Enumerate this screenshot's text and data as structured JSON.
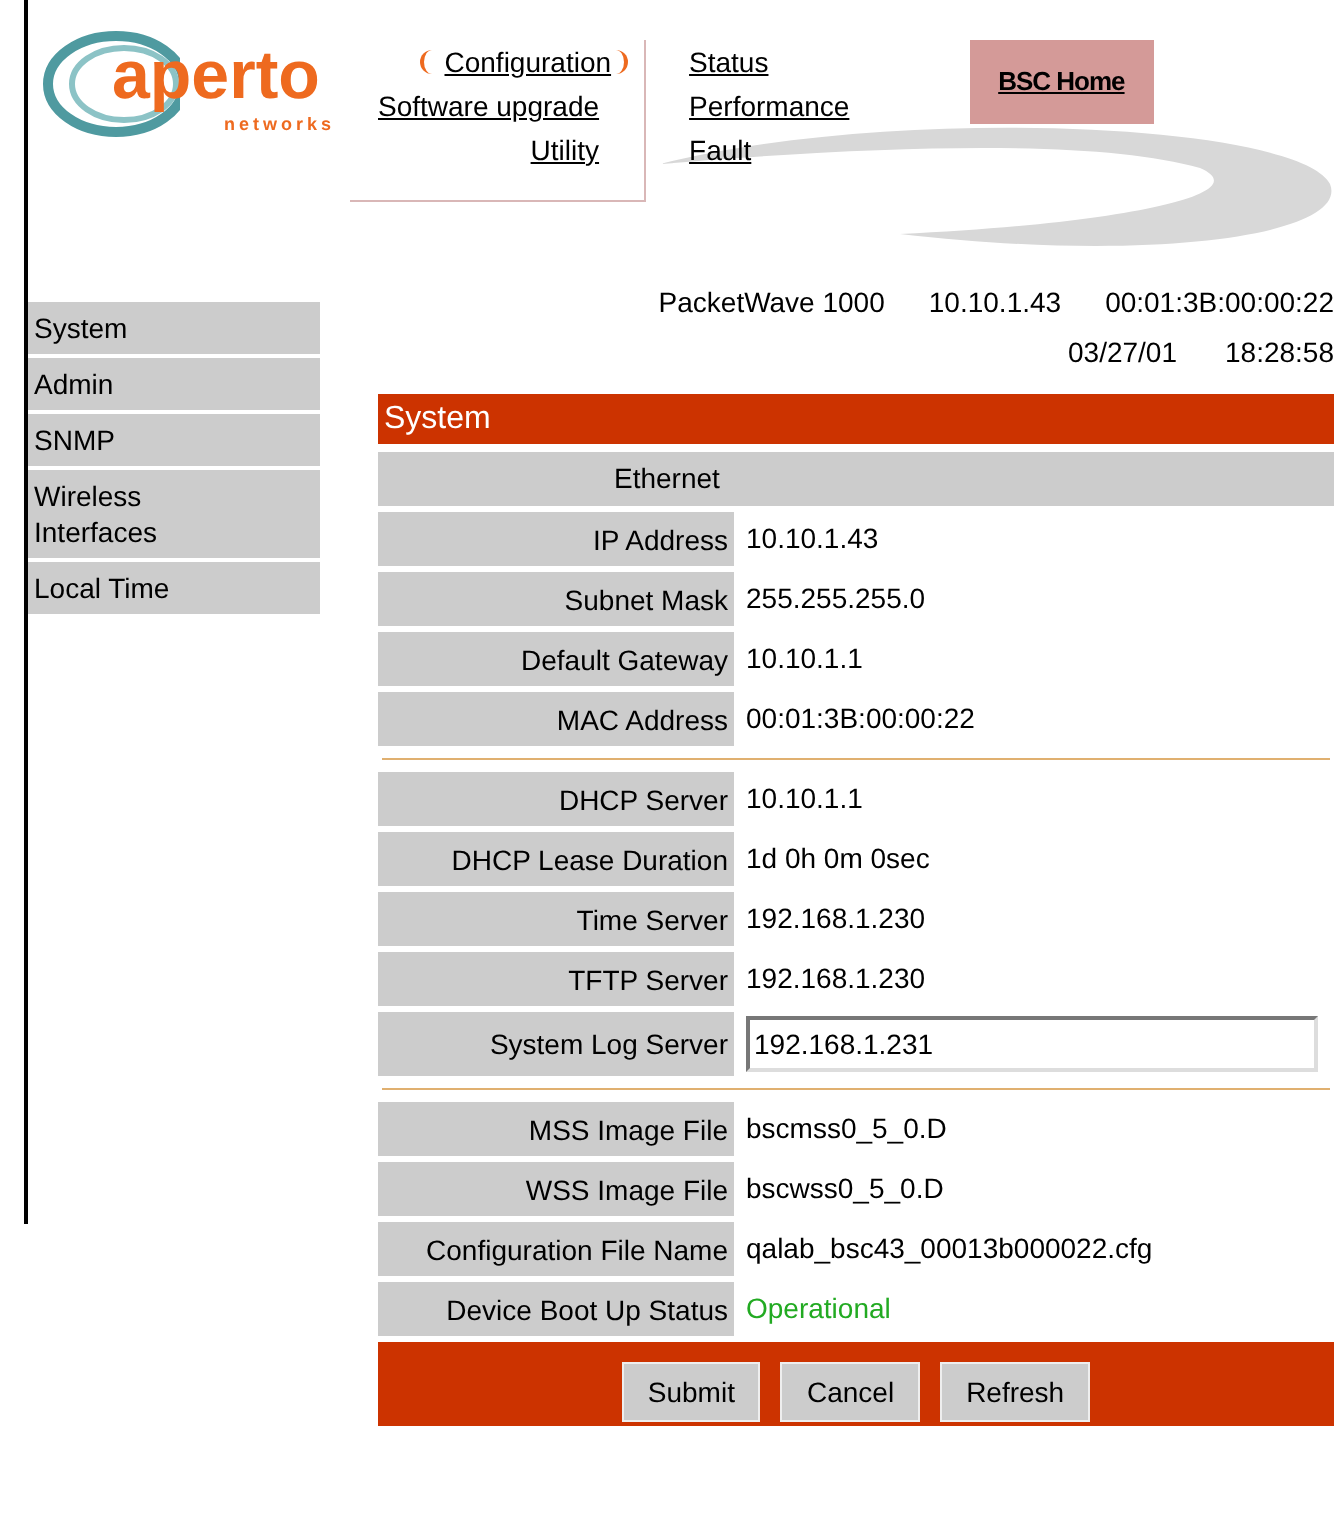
{
  "logo": {
    "name": "aperto",
    "tagline": "networks"
  },
  "nav": {
    "left": [
      {
        "label": "Configuration",
        "selected": true
      },
      {
        "label": "Software upgrade",
        "selected": false
      },
      {
        "label": "Utility",
        "selected": false
      }
    ],
    "right": [
      {
        "label": "Status"
      },
      {
        "label": "Performance"
      },
      {
        "label": "Fault"
      }
    ],
    "home": "BSC Home"
  },
  "device": {
    "model": "PacketWave 1000",
    "ip": "10.10.1.43",
    "mac": "00:01:3B:00:00:22",
    "date": "03/27/01",
    "time": "18:28:58"
  },
  "sidebar": {
    "items": [
      {
        "label": "System"
      },
      {
        "label": "Admin"
      },
      {
        "label": "SNMP"
      },
      {
        "label": "Wireless Interfaces"
      },
      {
        "label": "Local Time"
      }
    ]
  },
  "panel": {
    "title": "System",
    "subheading": "Ethernet",
    "sections": [
      {
        "rows": [
          {
            "kind": "text",
            "label": "IP Address",
            "value": "10.10.1.43"
          },
          {
            "kind": "text",
            "label": "Subnet Mask",
            "value": "255.255.255.0"
          },
          {
            "kind": "text",
            "label": "Default Gateway",
            "value": "10.10.1.1"
          },
          {
            "kind": "text",
            "label": "MAC Address",
            "value": "00:01:3B:00:00:22"
          }
        ]
      },
      {
        "rows": [
          {
            "kind": "text",
            "label": "DHCP Server",
            "value": "10.10.1.1"
          },
          {
            "kind": "text",
            "label": "DHCP Lease Duration",
            "value": "1d 0h 0m 0sec"
          },
          {
            "kind": "text",
            "label": "Time Server",
            "value": "192.168.1.230"
          },
          {
            "kind": "text",
            "label": "TFTP Server",
            "value": "192.168.1.230"
          },
          {
            "kind": "input",
            "label": "System Log Server",
            "value": "192.168.1.231"
          }
        ]
      },
      {
        "rows": [
          {
            "kind": "text",
            "label": "MSS Image File",
            "value": "bscmss0_5_0.D"
          },
          {
            "kind": "text",
            "label": "WSS Image File",
            "value": "bscwss0_5_0.D"
          },
          {
            "kind": "text",
            "label": "Configuration File Name",
            "value": "qalab_bsc43_00013b000022.cfg"
          },
          {
            "kind": "status",
            "label": "Device Boot Up Status",
            "value": "Operational"
          }
        ]
      }
    ],
    "buttons": [
      "Submit",
      "Cancel",
      "Refresh"
    ]
  }
}
